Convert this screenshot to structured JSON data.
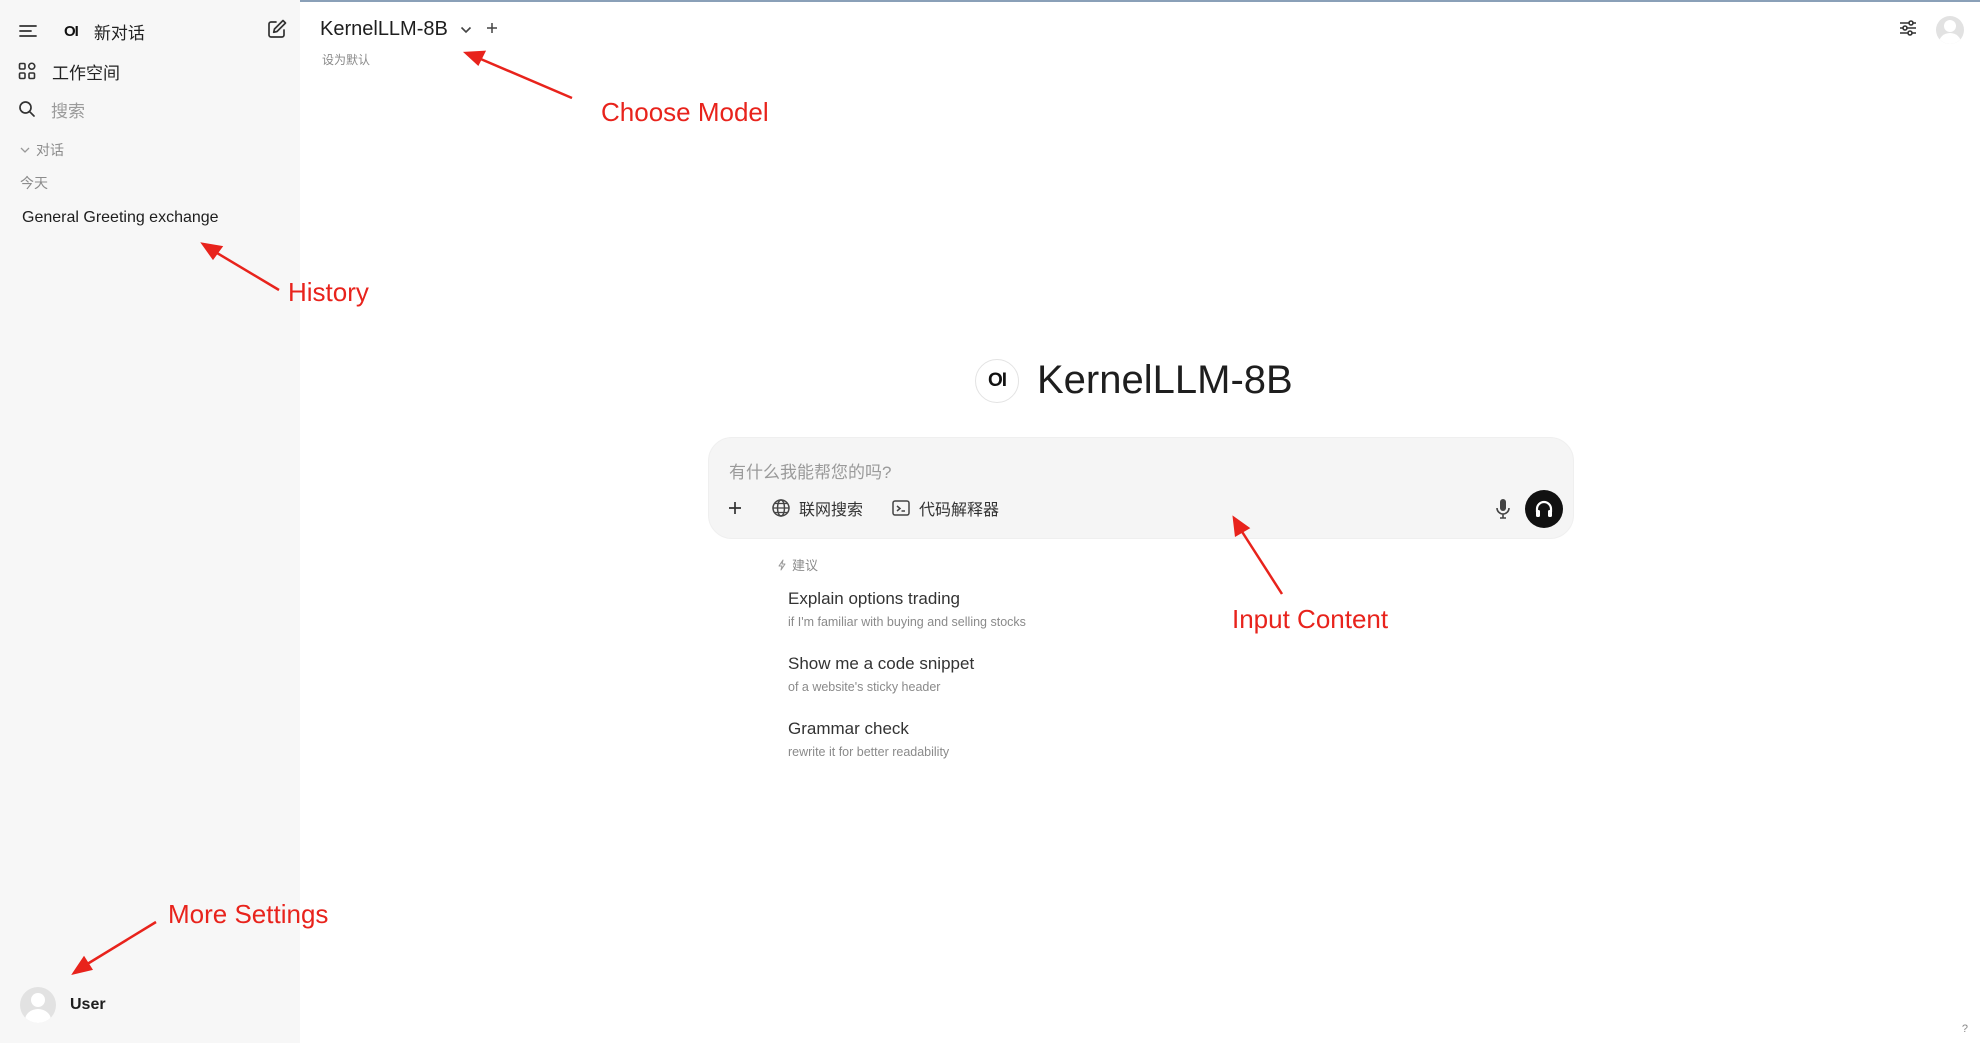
{
  "sidebar": {
    "logo_text": "OI",
    "new_chat_label": "新对话",
    "workspace_label": "工作空间",
    "search_placeholder": "搜索",
    "chats_section_label": "对话",
    "today_label": "今天",
    "history": [
      {
        "title": "General Greeting exchange"
      }
    ],
    "user_name": "User"
  },
  "header": {
    "model_name": "KernelLLM-8B",
    "set_default_label": "设为默认"
  },
  "main": {
    "logo_text": "OI",
    "title": "KernelLLM-8B",
    "input_placeholder": "有什么我能帮您的吗?",
    "tools": {
      "web_search_label": "联网搜索",
      "code_interpreter_label": "代码解释器"
    },
    "suggestions_label": "建议",
    "suggestions": [
      {
        "title": "Explain options trading",
        "subtitle": "if I'm familiar with buying and selling stocks"
      },
      {
        "title": "Show me a code snippet",
        "subtitle": "of a website's sticky header"
      },
      {
        "title": "Grammar check",
        "subtitle": "rewrite it for better readability"
      }
    ],
    "help_label": "?"
  },
  "annotations": {
    "choose_model": "Choose Model",
    "history": "History",
    "input_content": "Input Content",
    "more_settings": "More Settings"
  },
  "colors": {
    "annotation": "#e8231c",
    "sidebar_bg": "#f7f7f7",
    "composer_bg": "#f5f5f5",
    "call_button": "#111111"
  },
  "icons": {
    "menu": "menu-icon",
    "edit": "edit-icon",
    "workspace": "grid-icon",
    "search": "search-icon",
    "chevron": "chevron-down-icon",
    "plus": "plus-icon",
    "controls": "sliders-icon",
    "globe": "globe-icon",
    "terminal": "terminal-icon",
    "mic": "mic-icon",
    "headphones": "headphones-icon",
    "sparkle": "sparkle-icon"
  }
}
